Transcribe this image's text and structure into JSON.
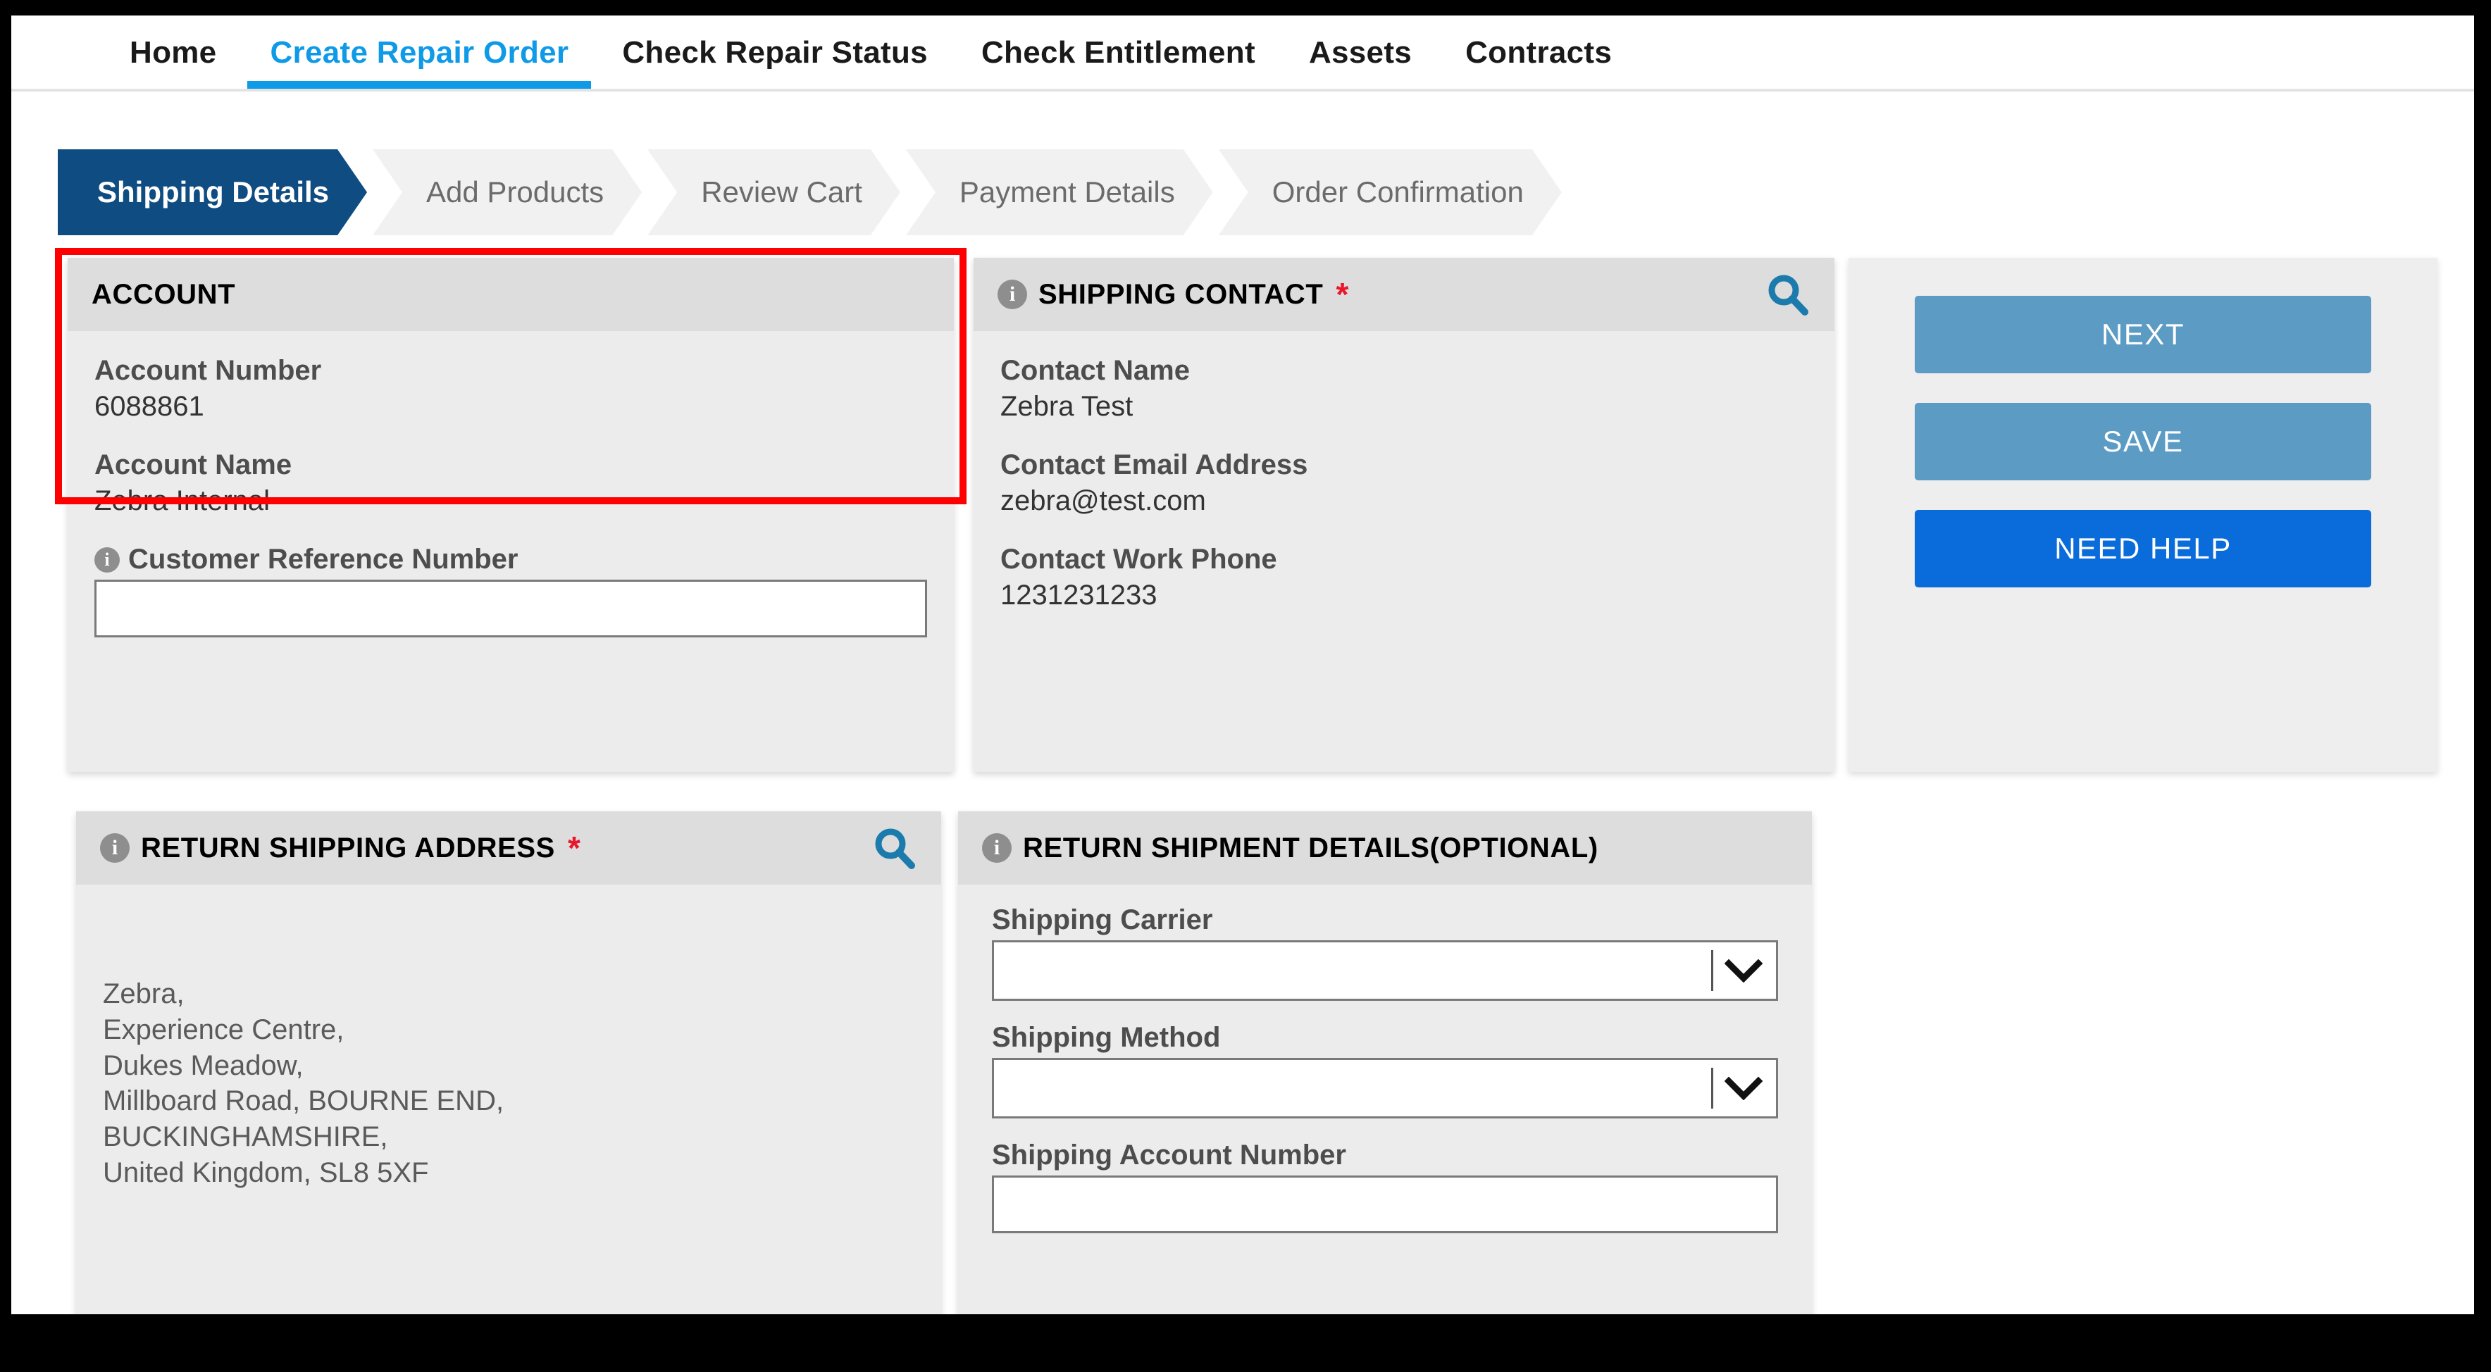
{
  "nav": {
    "items": [
      {
        "label": "Home",
        "active": false
      },
      {
        "label": "Create Repair Order",
        "active": true
      },
      {
        "label": "Check Repair Status",
        "active": false
      },
      {
        "label": "Check Entitlement",
        "active": false
      },
      {
        "label": "Assets",
        "active": false
      },
      {
        "label": "Contracts",
        "active": false
      }
    ]
  },
  "steps": [
    {
      "label": "Shipping Details",
      "active": true
    },
    {
      "label": "Add Products",
      "active": false
    },
    {
      "label": "Review Cart",
      "active": false
    },
    {
      "label": "Payment Details",
      "active": false
    },
    {
      "label": "Order Confirmation",
      "active": false
    }
  ],
  "account_card": {
    "title": "ACCOUNT",
    "fields": {
      "account_number_label": "Account Number",
      "account_number_value": "6088861",
      "account_name_label": "Account Name",
      "account_name_value": "Zebra Internal",
      "customer_reference_label": "Customer Reference Number",
      "customer_reference_value": "",
      "customer_reference_placeholder": ""
    },
    "info_icon": "info-icon"
  },
  "shipping_contact_card": {
    "title": "SHIPPING CONTACT",
    "required_marker": "*",
    "search_icon": "search-icon",
    "info_icon": "info-icon",
    "fields": {
      "contact_name_label": "Contact Name",
      "contact_name_value": "Zebra Test",
      "contact_email_label": "Contact Email Address",
      "contact_email_value": "zebra@test.com",
      "contact_phone_label": "Contact Work Phone",
      "contact_phone_value": "1231231233"
    }
  },
  "actions": {
    "next_label": "NEXT",
    "save_label": "SAVE",
    "need_help_label": "NEED HELP"
  },
  "return_address_card": {
    "title": "RETURN SHIPPING ADDRESS",
    "required_marker": "*",
    "search_icon": "search-icon",
    "info_icon": "info-icon",
    "address_lines": [
      "Zebra,",
      "Experience Centre,",
      "Dukes Meadow,",
      "Millboard Road, BOURNE END,",
      "BUCKINGHAMSHIRE,",
      "United Kingdom, SL8 5XF"
    ]
  },
  "return_shipment_card": {
    "title": "RETURN SHIPMENT DETAILS(OPTIONAL)",
    "info_icon": "info-icon",
    "fields": {
      "shipping_carrier_label": "Shipping Carrier",
      "shipping_carrier_value": "",
      "shipping_method_label": "Shipping Method",
      "shipping_method_value": "",
      "shipping_account_number_label": "Shipping Account Number",
      "shipping_account_number_value": ""
    }
  },
  "colors": {
    "accent_blue": "#0f9ae8",
    "step_active": "#0f4c81",
    "button_secondary": "#5b9bc4",
    "button_primary": "#0a6bda",
    "required_red": "#e8172a",
    "annotation_red": "#ff0000",
    "search_icon_blue": "#1b7bac"
  }
}
